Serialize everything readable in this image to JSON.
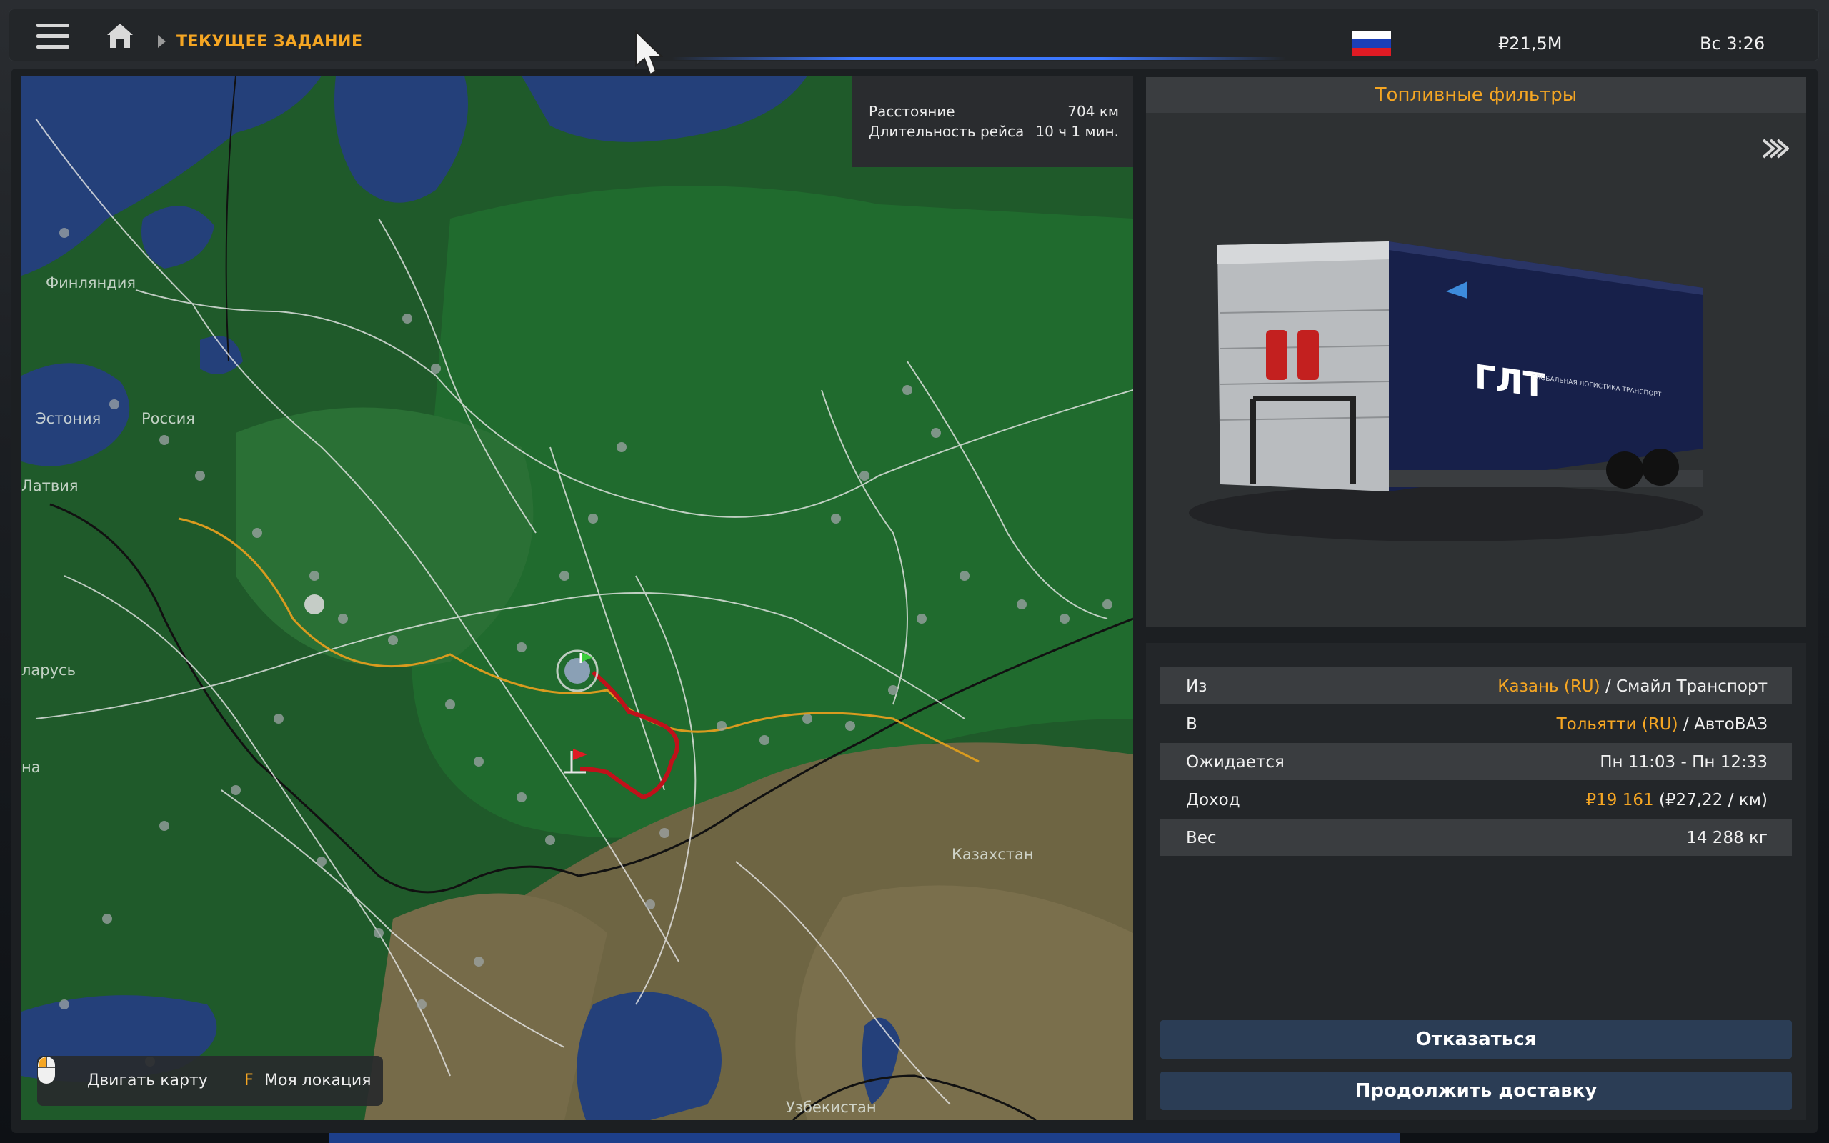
{
  "topbar": {
    "breadcrumb": "ТЕКУЩЕЕ ЗАДАНИЕ",
    "money": "₽21,5M",
    "clock": "Вс 3:26",
    "flag_colors": [
      "#ffffff",
      "#1c3fb8",
      "#e01b24"
    ]
  },
  "map": {
    "info": {
      "distance_label": "Расстояние",
      "distance_value": "704 км",
      "duration_label": "Длительность рейса",
      "duration_value": "10 ч 1 мин."
    },
    "countries": [
      "Финляндия",
      "Эстония",
      "Россия",
      "Латвия",
      "ларусь",
      "на",
      "Казахстан",
      "Узбекистан"
    ],
    "controls": {
      "move_map": "Двигать карту",
      "location_key": "F",
      "my_location": "Моя локация"
    }
  },
  "cargo": {
    "name": "Топливные фильтры",
    "trailer_brand": "ГЛТ",
    "trailer_brand_sub": "ГЛОБАЛЬНАЯ ЛОГИСТИКА ТРАНСПОРТ"
  },
  "details": {
    "from": {
      "label": "Из",
      "city": "Казань (RU)",
      "company": " / Смайл Транспорт"
    },
    "to": {
      "label": "В",
      "city": "Тольятти (RU)",
      "company": " / АвтоВАЗ"
    },
    "expected": {
      "label": "Ожидается",
      "value": "Пн 11:03 - Пн 12:33"
    },
    "income": {
      "label": "Доход",
      "value": "₽19 161",
      "rate": " (₽27,22 / км)"
    },
    "weight": {
      "label": "Вес",
      "value": "14 288 кг"
    }
  },
  "buttons": {
    "decline": "Отказаться",
    "continue": "Продолжить доставку"
  },
  "colors": {
    "accent": "#f5a623",
    "button": "#2b3d55",
    "route": "#c0111a"
  }
}
